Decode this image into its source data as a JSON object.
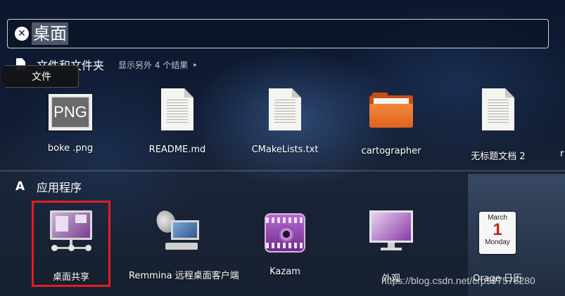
{
  "search": {
    "query": "桌面",
    "clear_icon": "close-circle-icon"
  },
  "files_section": {
    "title": "文件和文件夹",
    "icon": "document-icon",
    "more_results": "显示另外 4 个结果",
    "more_arrow": "▸",
    "tooltip": "文件",
    "items": [
      {
        "label": "boke .png",
        "icon": "png-image-icon",
        "icon_text": "PNG"
      },
      {
        "label": "README.md",
        "icon": "text-file-icon"
      },
      {
        "label": "CMakeLists.txt",
        "icon": "text-file-icon"
      },
      {
        "label": "cartographer",
        "icon": "folder-icon"
      },
      {
        "label": "无标题文档 2",
        "icon": "text-file-icon"
      }
    ],
    "edge_label": "r"
  },
  "apps_section": {
    "title": "应用程序",
    "icon": "applications-icon",
    "icon_glyph": "A",
    "items": [
      {
        "label": "桌面共享",
        "icon": "desktop-sharing-icon"
      },
      {
        "label": "Remmina 远程桌面客户端",
        "icon": "remmina-icon"
      },
      {
        "label": "Kazam",
        "icon": "kazam-icon"
      },
      {
        "label": "外观",
        "icon": "appearance-icon"
      },
      {
        "label": "Orage 日历",
        "icon": "calendar-icon",
        "calendar": {
          "month": "March",
          "day": "1",
          "weekday": "Monday"
        }
      }
    ]
  },
  "watermark": "https://blog.csdn.net/crp997576280",
  "colors": {
    "highlight": "#e31e1e",
    "folder": "#e1621d",
    "accent_purple": "#8b3aa8"
  }
}
